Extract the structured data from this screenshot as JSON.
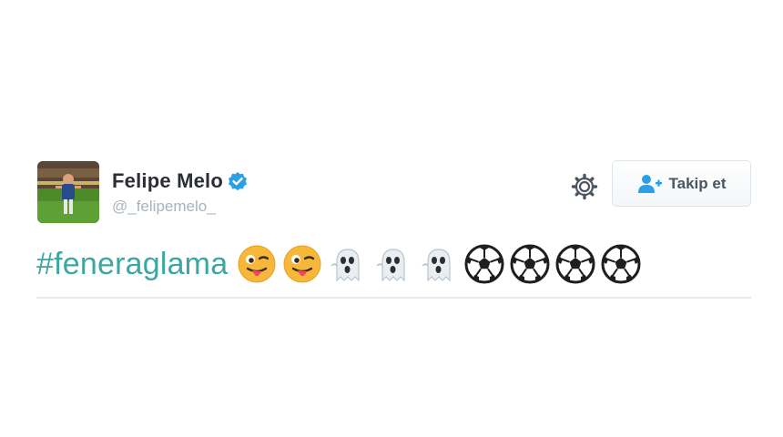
{
  "tweet": {
    "author": {
      "display_name": "Felipe Melo",
      "handle": "@_felipemelo_",
      "verified": true,
      "avatar_icon": "football-player-photo"
    },
    "actions": {
      "settings_icon": "gear-icon",
      "follow_label": "Takip et",
      "follow_icon": "add-user-icon"
    },
    "text": {
      "hashtag": "#feneraglama",
      "emojis": [
        "winking-face-with-tongue",
        "winking-face-with-tongue",
        "ghost",
        "ghost",
        "ghost",
        "soccer-ball",
        "soccer-ball",
        "soccer-ball",
        "soccer-ball"
      ]
    },
    "colors": {
      "hashtag": "#3aa7a3",
      "verified": "#2aa0e8",
      "name": "#2b2f33",
      "handle": "#a8b3bc",
      "divider": "#e7ebee"
    }
  }
}
